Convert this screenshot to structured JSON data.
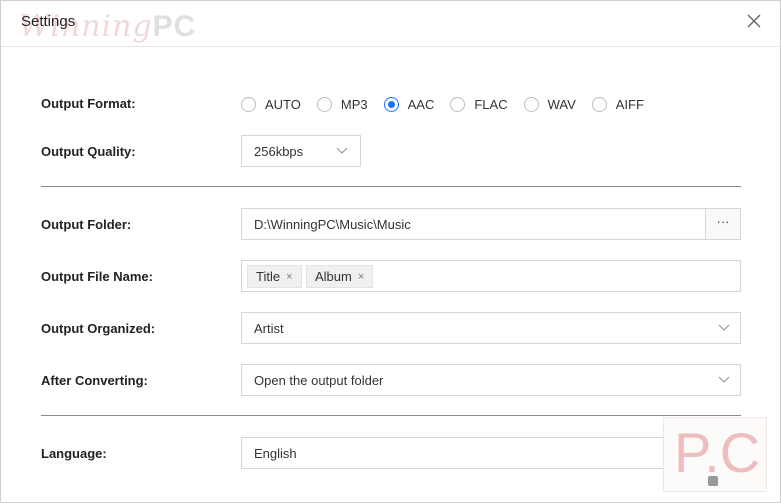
{
  "window": {
    "title": "Settings"
  },
  "watermark": {
    "script": "Winning",
    "bold": "PC"
  },
  "output_format": {
    "label": "Output Format:",
    "options": [
      "AUTO",
      "MP3",
      "AAC",
      "FLAC",
      "WAV",
      "AIFF"
    ],
    "selected": "AAC"
  },
  "output_quality": {
    "label": "Output Quality:",
    "value": "256kbps"
  },
  "output_folder": {
    "label": "Output Folder:",
    "value": "D:\\WinningPC\\Music\\Music",
    "browse_label": "···"
  },
  "output_file_name": {
    "label": "Output File Name:",
    "tags": [
      "Title",
      "Album"
    ],
    "remove_glyph": "×"
  },
  "output_organized": {
    "label": "Output Organized:",
    "value": "Artist"
  },
  "after_converting": {
    "label": "After Converting:",
    "value": "Open the output folder"
  },
  "language": {
    "label": "Language:",
    "value": "English"
  },
  "corner_logo": {
    "text": "P.C"
  },
  "colors": {
    "accent": "#1a73e8",
    "border": "#d6d6d6",
    "divider": "#8a8a8a"
  }
}
